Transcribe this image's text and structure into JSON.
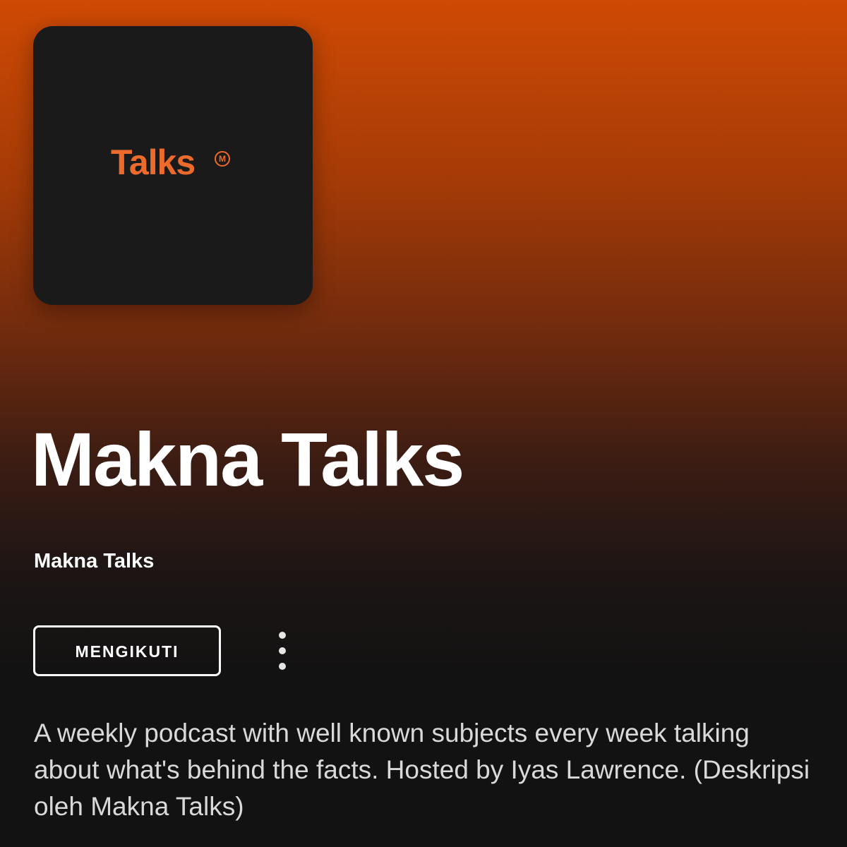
{
  "cover": {
    "logo_text": "Talks",
    "logo_mark": "M",
    "logo_color": "#ec6a2b",
    "background_color": "#1a1a1a"
  },
  "podcast": {
    "title": "Makna Talks",
    "publisher": "Makna Talks",
    "description": "A weekly podcast with well known subjects every week talking about what's behind the facts. Hosted by Iyas Lawrence. (Deskripsi oleh Makna Talks)"
  },
  "actions": {
    "follow_label": "MENGIKUTI",
    "more_icon": "more-vertical-icon"
  },
  "theme": {
    "gradient_top": "#cf4a04",
    "background": "#121212",
    "text": "#ffffff"
  }
}
